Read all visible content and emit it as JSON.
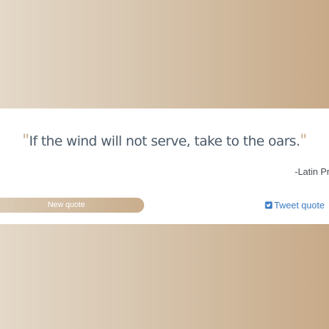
{
  "quote": {
    "open_mark": "\"",
    "text": "If the wind will not serve, take to the oars.",
    "close_mark": "\"",
    "author": "-Latin Pr"
  },
  "actions": {
    "new_quote_label": "New quote",
    "tweet_label": "Tweet quote",
    "tweet_icon": "twitter-icon"
  },
  "colors": {
    "background_start": "#e4d8c8",
    "background_end": "#c7aa88",
    "quote_text": "#4b5a68",
    "quote_mark": "#c7ab8a",
    "tweet_link": "#3b7bc4"
  }
}
